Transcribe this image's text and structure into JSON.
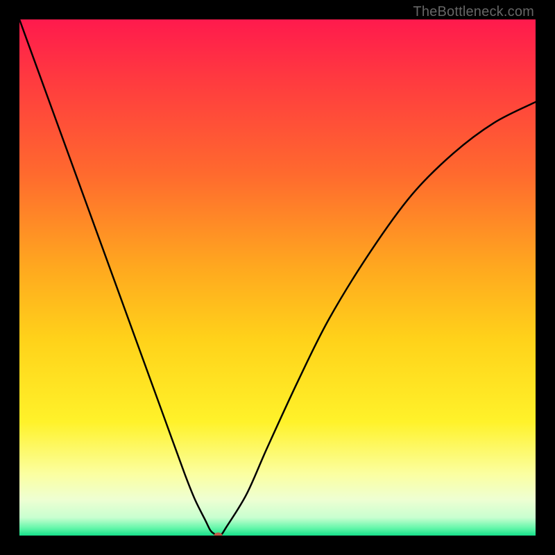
{
  "watermark": "TheBottleneck.com",
  "chart_data": {
    "type": "line",
    "title": "",
    "xlabel": "",
    "ylabel": "",
    "xlim": [
      0,
      100
    ],
    "ylim": [
      0,
      100
    ],
    "background_gradient": {
      "stops": [
        {
          "offset": 0.0,
          "color": "#ff1a4d"
        },
        {
          "offset": 0.12,
          "color": "#ff3b3f"
        },
        {
          "offset": 0.3,
          "color": "#ff6a2e"
        },
        {
          "offset": 0.48,
          "color": "#ffa81f"
        },
        {
          "offset": 0.62,
          "color": "#ffd21a"
        },
        {
          "offset": 0.78,
          "color": "#fff22a"
        },
        {
          "offset": 0.88,
          "color": "#fbffa0"
        },
        {
          "offset": 0.93,
          "color": "#eeffd2"
        },
        {
          "offset": 0.965,
          "color": "#c9ffd0"
        },
        {
          "offset": 0.985,
          "color": "#66f7ab"
        },
        {
          "offset": 1.0,
          "color": "#16e08a"
        }
      ]
    },
    "series": [
      {
        "name": "bottleneck-curve",
        "x": [
          0,
          4,
          8,
          12,
          16,
          20,
          24,
          28,
          32,
          34,
          36,
          37,
          37.8,
          38.5,
          39.2,
          40,
          44,
          48,
          54,
          60,
          68,
          76,
          84,
          92,
          100
        ],
        "y": [
          100,
          89,
          78,
          67,
          56,
          45,
          34,
          23,
          12,
          7,
          3,
          1,
          0.3,
          0,
          0.3,
          1.5,
          8,
          17,
          30,
          42,
          55,
          66,
          74,
          80,
          84
        ]
      }
    ],
    "marker": {
      "name": "optimum-point",
      "x": 38.5,
      "y": 0,
      "color": "#c0614b",
      "rx": 6,
      "ry": 4.5
    }
  }
}
